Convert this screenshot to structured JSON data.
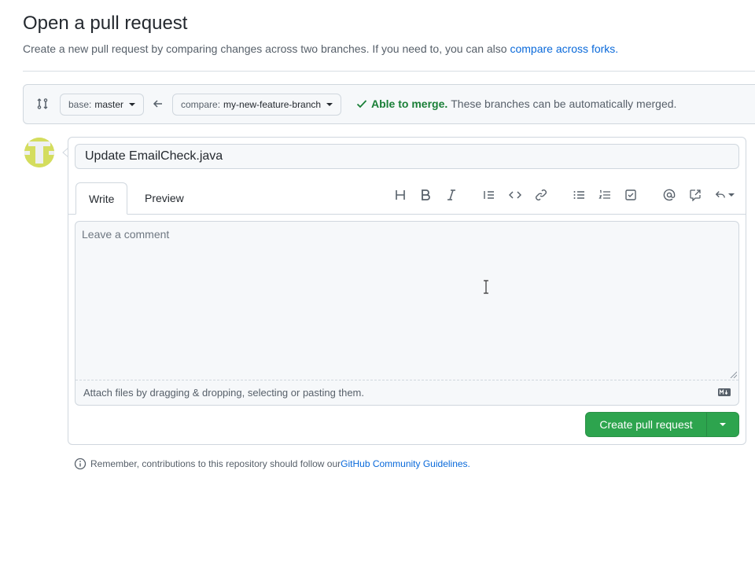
{
  "header": {
    "title": "Open a pull request",
    "subtitle": "Create a new pull request by comparing changes across two branches. If you need to, you can also ",
    "subtitle_link": "compare across forks."
  },
  "range": {
    "base_label": "base:",
    "base_value": "master",
    "compare_label": "compare:",
    "compare_value": "my-new-feature-branch",
    "merge_status": "Able to merge.",
    "merge_detail": "These branches can be automatically merged."
  },
  "form": {
    "title_value": "Update EmailCheck.java",
    "tabs": [
      {
        "label": "Write",
        "active": true
      },
      {
        "label": "Preview",
        "active": false
      }
    ],
    "toolbar": [
      "heading-icon",
      "bold-icon",
      "italic-icon",
      "quote-icon",
      "code-icon",
      "link-icon",
      "bulleted-list-icon",
      "numbered-list-icon",
      "task-list-icon",
      "mention-icon",
      "cross-reference-icon",
      "saved-reply-icon"
    ],
    "comment_placeholder": "Leave a comment",
    "attach_text": "Attach files by dragging & dropping, selecting or pasting them.",
    "submit_label": "Create pull request"
  },
  "footer": {
    "note": "Remember, contributions to this repository should follow our ",
    "link": "GitHub Community Guidelines."
  },
  "colors": {
    "accent_blue": "#0969da",
    "success_green": "#2da44e",
    "merge_green": "#1a7f37",
    "avatar_lime": "#d4dd5e"
  }
}
